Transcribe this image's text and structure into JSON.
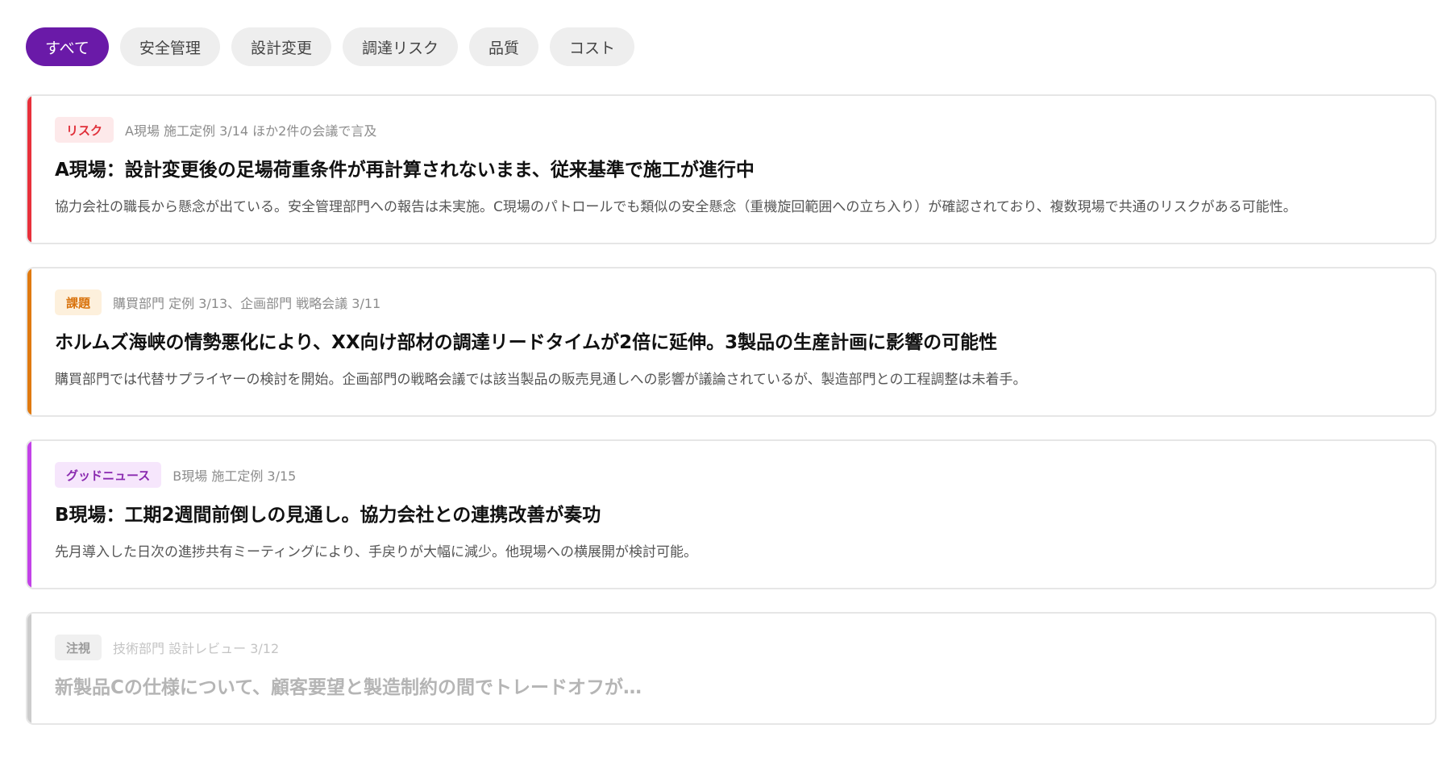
{
  "filters": [
    {
      "label": "すべて"
    },
    {
      "label": "安全管理"
    },
    {
      "label": "設計変更"
    },
    {
      "label": "調達リスク"
    },
    {
      "label": "品質"
    },
    {
      "label": "コスト"
    }
  ],
  "active_filter": "すべて",
  "colors": {
    "accent_primary": "#6a1aa8",
    "risk": "#e8303b",
    "issue": "#e07a10",
    "good_news": "#c342e8",
    "watch": "#cccccc"
  },
  "cards": [
    {
      "tag": "リスク",
      "source": "A現場 施工定例 3/14 ほか2件の会議で言及",
      "title": "A現場：設計変更後の足場荷重条件が再計算されないまま、従来基準で施工が進行中",
      "body": "協力会社の職長から懸念が出ている。安全管理部門への報告は未実施。C現場のパトロールでも類似の安全懸念（重機旋回範囲への立ち入り）が確認されており、複数現場で共通のリスクがある可能性。"
    },
    {
      "tag": "課題",
      "source": "購買部門 定例 3/13、企画部門 戦略会議 3/11",
      "title": "ホルムズ海峡の情勢悪化により、XX向け部材の調達リードタイムが2倍に延伸。3製品の生産計画に影響の可能性",
      "body": "購買部門では代替サプライヤーの検討を開始。企画部門の戦略会議では該当製品の販売見通しへの影響が議論されているが、製造部門との工程調整は未着手。"
    },
    {
      "tag": "グッドニュース",
      "source": "B現場 施工定例 3/15",
      "title": "B現場：工期2週間前倒しの見通し。協力会社との連携改善が奏功",
      "body": "先月導入した日次の進捗共有ミーティングにより、手戻りが大幅に減少。他現場への横展開が検討可能。"
    },
    {
      "tag": "注視",
      "source": "技術部門 設計レビュー 3/12",
      "title": "新製品Cの仕様について、顧客要望と製造制約の間でトレードオフが…"
    }
  ]
}
